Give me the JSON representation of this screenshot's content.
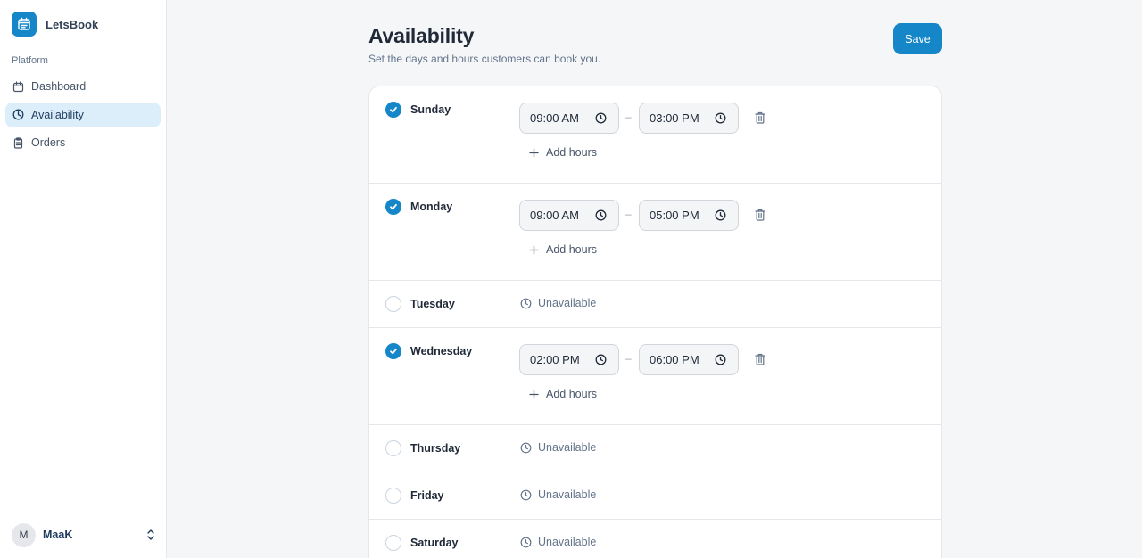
{
  "app": {
    "name": "LetsBook",
    "logo_icon": "calendar-icon",
    "accent": "#1586c7"
  },
  "sidebar": {
    "section_label": "Platform",
    "items": [
      {
        "label": "Dashboard",
        "icon": "calendar-icon",
        "active": false
      },
      {
        "label": "Availability",
        "icon": "clock-icon",
        "active": true
      },
      {
        "label": "Orders",
        "icon": "clipboard-icon",
        "active": false
      }
    ],
    "user": {
      "initial": "M",
      "name": "MaaK"
    }
  },
  "header": {
    "title": "Availability",
    "subtitle": "Set the days and hours customers can book you.",
    "save_label": "Save"
  },
  "days": [
    {
      "name": "Sunday",
      "enabled": true,
      "ranges": [
        {
          "start": "09:00 AM",
          "end": "03:00 PM"
        }
      ],
      "add_label": "Add hours"
    },
    {
      "name": "Monday",
      "enabled": true,
      "ranges": [
        {
          "start": "09:00 AM",
          "end": "05:00 PM"
        }
      ],
      "add_label": "Add hours"
    },
    {
      "name": "Tuesday",
      "enabled": false,
      "status": "Unavailable"
    },
    {
      "name": "Wednesday",
      "enabled": true,
      "ranges": [
        {
          "start": "02:00 PM",
          "end": "06:00 PM"
        }
      ],
      "add_label": "Add hours"
    },
    {
      "name": "Thursday",
      "enabled": false,
      "status": "Unavailable"
    },
    {
      "name": "Friday",
      "enabled": false,
      "status": "Unavailable"
    },
    {
      "name": "Saturday",
      "enabled": false,
      "status": "Unavailable"
    }
  ],
  "range_separator": "–"
}
